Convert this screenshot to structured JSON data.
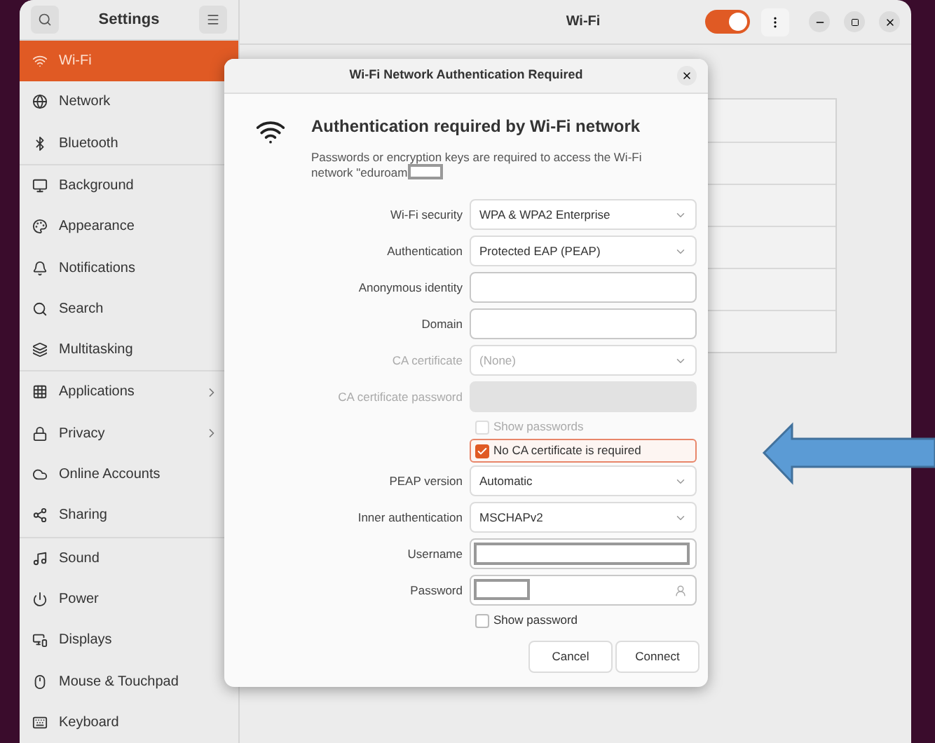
{
  "sidebar": {
    "title": "Settings",
    "groups": [
      [
        {
          "label": "Wi-Fi",
          "selected": true,
          "chevron": false
        },
        {
          "label": "Network",
          "selected": false,
          "chevron": false
        },
        {
          "label": "Bluetooth",
          "selected": false,
          "chevron": false
        }
      ],
      [
        {
          "label": "Background",
          "selected": false,
          "chevron": false
        },
        {
          "label": "Appearance",
          "selected": false,
          "chevron": false
        },
        {
          "label": "Notifications",
          "selected": false,
          "chevron": false
        },
        {
          "label": "Search",
          "selected": false,
          "chevron": false
        },
        {
          "label": "Multitasking",
          "selected": false,
          "chevron": false
        }
      ],
      [
        {
          "label": "Applications",
          "selected": false,
          "chevron": true
        },
        {
          "label": "Privacy",
          "selected": false,
          "chevron": true
        },
        {
          "label": "Online Accounts",
          "selected": false,
          "chevron": false
        },
        {
          "label": "Sharing",
          "selected": false,
          "chevron": false
        }
      ],
      [
        {
          "label": "Sound",
          "selected": false,
          "chevron": false
        },
        {
          "label": "Power",
          "selected": false,
          "chevron": false
        },
        {
          "label": "Displays",
          "selected": false,
          "chevron": false
        },
        {
          "label": "Mouse & Touchpad",
          "selected": false,
          "chevron": false
        },
        {
          "label": "Keyboard",
          "selected": false,
          "chevron": false
        }
      ]
    ]
  },
  "header": {
    "title": "Wi-Fi",
    "wifi_on": true
  },
  "dialog": {
    "title": "Wi-Fi Network Authentication Required",
    "heading": "Authentication required by Wi-Fi network",
    "description": "Passwords or encryption keys are required to access the Wi-Fi network \"eduroam",
    "description_redacted": true,
    "rows": [
      {
        "kind": "select",
        "label": "Wi-Fi security",
        "value": "WPA & WPA2 Enterprise",
        "disabled": false
      },
      {
        "kind": "select",
        "label": "Authentication",
        "value": "Protected EAP (PEAP)",
        "disabled": false
      },
      {
        "kind": "text",
        "label": "Anonymous identity",
        "disabled": false,
        "redacted": false
      },
      {
        "kind": "text",
        "label": "Domain",
        "disabled": false,
        "redacted": false
      },
      {
        "kind": "select",
        "label": "CA certificate",
        "value": "(None)",
        "disabled": true
      },
      {
        "kind": "text",
        "label": "CA certificate password",
        "disabled": true,
        "redacted": false
      },
      {
        "kind": "checkbox",
        "label": "Show passwords",
        "checked": false,
        "disabled": true,
        "focused": false
      },
      {
        "kind": "checkbox",
        "label": "No CA certificate is required",
        "checked": true,
        "disabled": false,
        "focused": true
      },
      {
        "kind": "select",
        "label": "PEAP version",
        "value": "Automatic",
        "disabled": false
      },
      {
        "kind": "select",
        "label": "Inner authentication",
        "value": "MSCHAPv2",
        "disabled": false
      },
      {
        "kind": "text",
        "label": "Username",
        "disabled": false,
        "redacted": true
      },
      {
        "kind": "password",
        "label": "Password",
        "disabled": false,
        "redacted": true
      },
      {
        "kind": "checkbox",
        "label": "Show password",
        "checked": false,
        "disabled": false,
        "focused": false
      }
    ],
    "buttons": [
      "Cancel",
      "Connect"
    ]
  }
}
